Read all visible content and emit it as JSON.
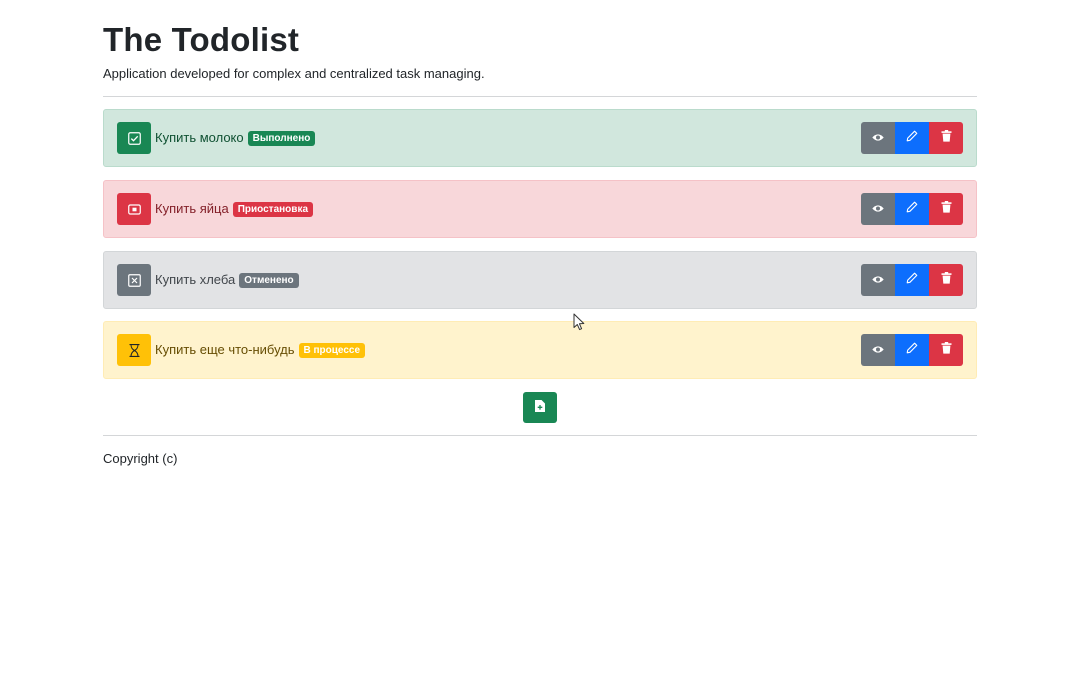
{
  "header": {
    "title": "The Todolist",
    "subtitle": "Application developed for complex and centralized task managing."
  },
  "tasks": [
    {
      "text": "Купить молоко",
      "status": "Выполнено",
      "variant": "success",
      "status_icon": "check-square-icon",
      "accent": "#198754"
    },
    {
      "text": "Купить яйца",
      "status": "Приостановка",
      "variant": "danger",
      "status_icon": "stop-circle-icon",
      "accent": "#dc3545"
    },
    {
      "text": "Купить хлеба",
      "status": "Отменено",
      "variant": "secondary",
      "status_icon": "x-square-icon",
      "accent": "#6c757d"
    },
    {
      "text": "Купить еще что-нибудь",
      "status": "В процессе",
      "variant": "warning",
      "status_icon": "hourglass-icon",
      "accent": "#ffc107"
    }
  ],
  "task_actions": {
    "view_icon": "eye-icon",
    "edit_icon": "pencil-icon",
    "delete_icon": "trash-icon",
    "view_color": "#6c757d",
    "edit_color": "#0d6efd",
    "delete_color": "#dc3545"
  },
  "add_button": {
    "icon": "file-plus-icon",
    "color": "#198754"
  },
  "footer": {
    "copyright": "Copyright (c)"
  }
}
